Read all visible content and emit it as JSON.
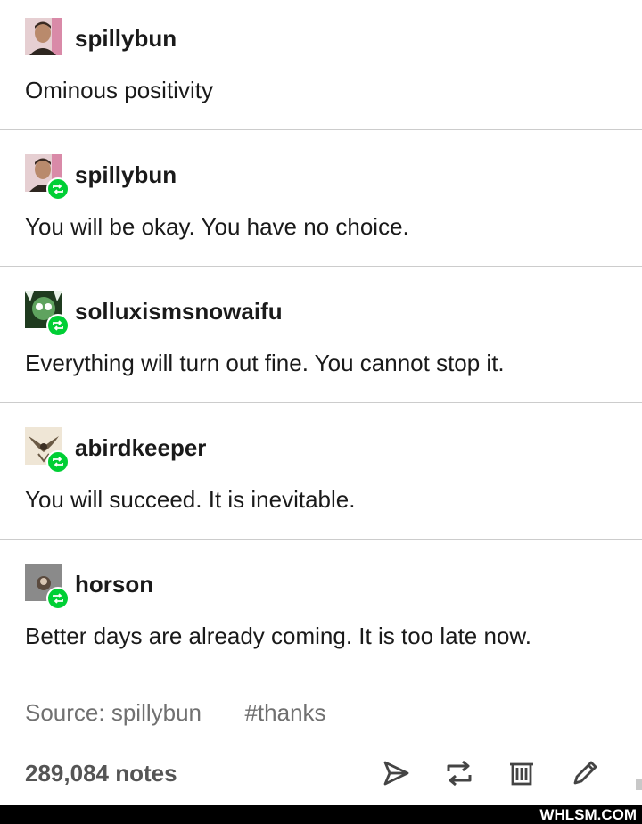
{
  "posts": [
    {
      "username": "spillybun",
      "text": "Ominous positivity",
      "reblog": false
    },
    {
      "username": "spillybun",
      "text": "You will be okay. You have no choice.",
      "reblog": true
    },
    {
      "username": "solluxismsnowaifu",
      "text": "Everything will turn out fine. You cannot stop it.",
      "reblog": true
    },
    {
      "username": "abirdkeeper",
      "text": "You will succeed. It is inevitable.",
      "reblog": true
    },
    {
      "username": "horson",
      "text": "Better days are already coming. It is too late now.",
      "reblog": true
    }
  ],
  "footer": {
    "source": "Source: spillybun",
    "tag": "#thanks",
    "notes": "289,084 notes"
  },
  "actions": [
    "share-icon",
    "reblog-icon",
    "delete-icon",
    "edit-icon"
  ],
  "watermark": "WHLSM.COM",
  "colors": {
    "reblog_badge": "#00cf35",
    "divider": "#cccccc",
    "muted_text": "#707070"
  }
}
